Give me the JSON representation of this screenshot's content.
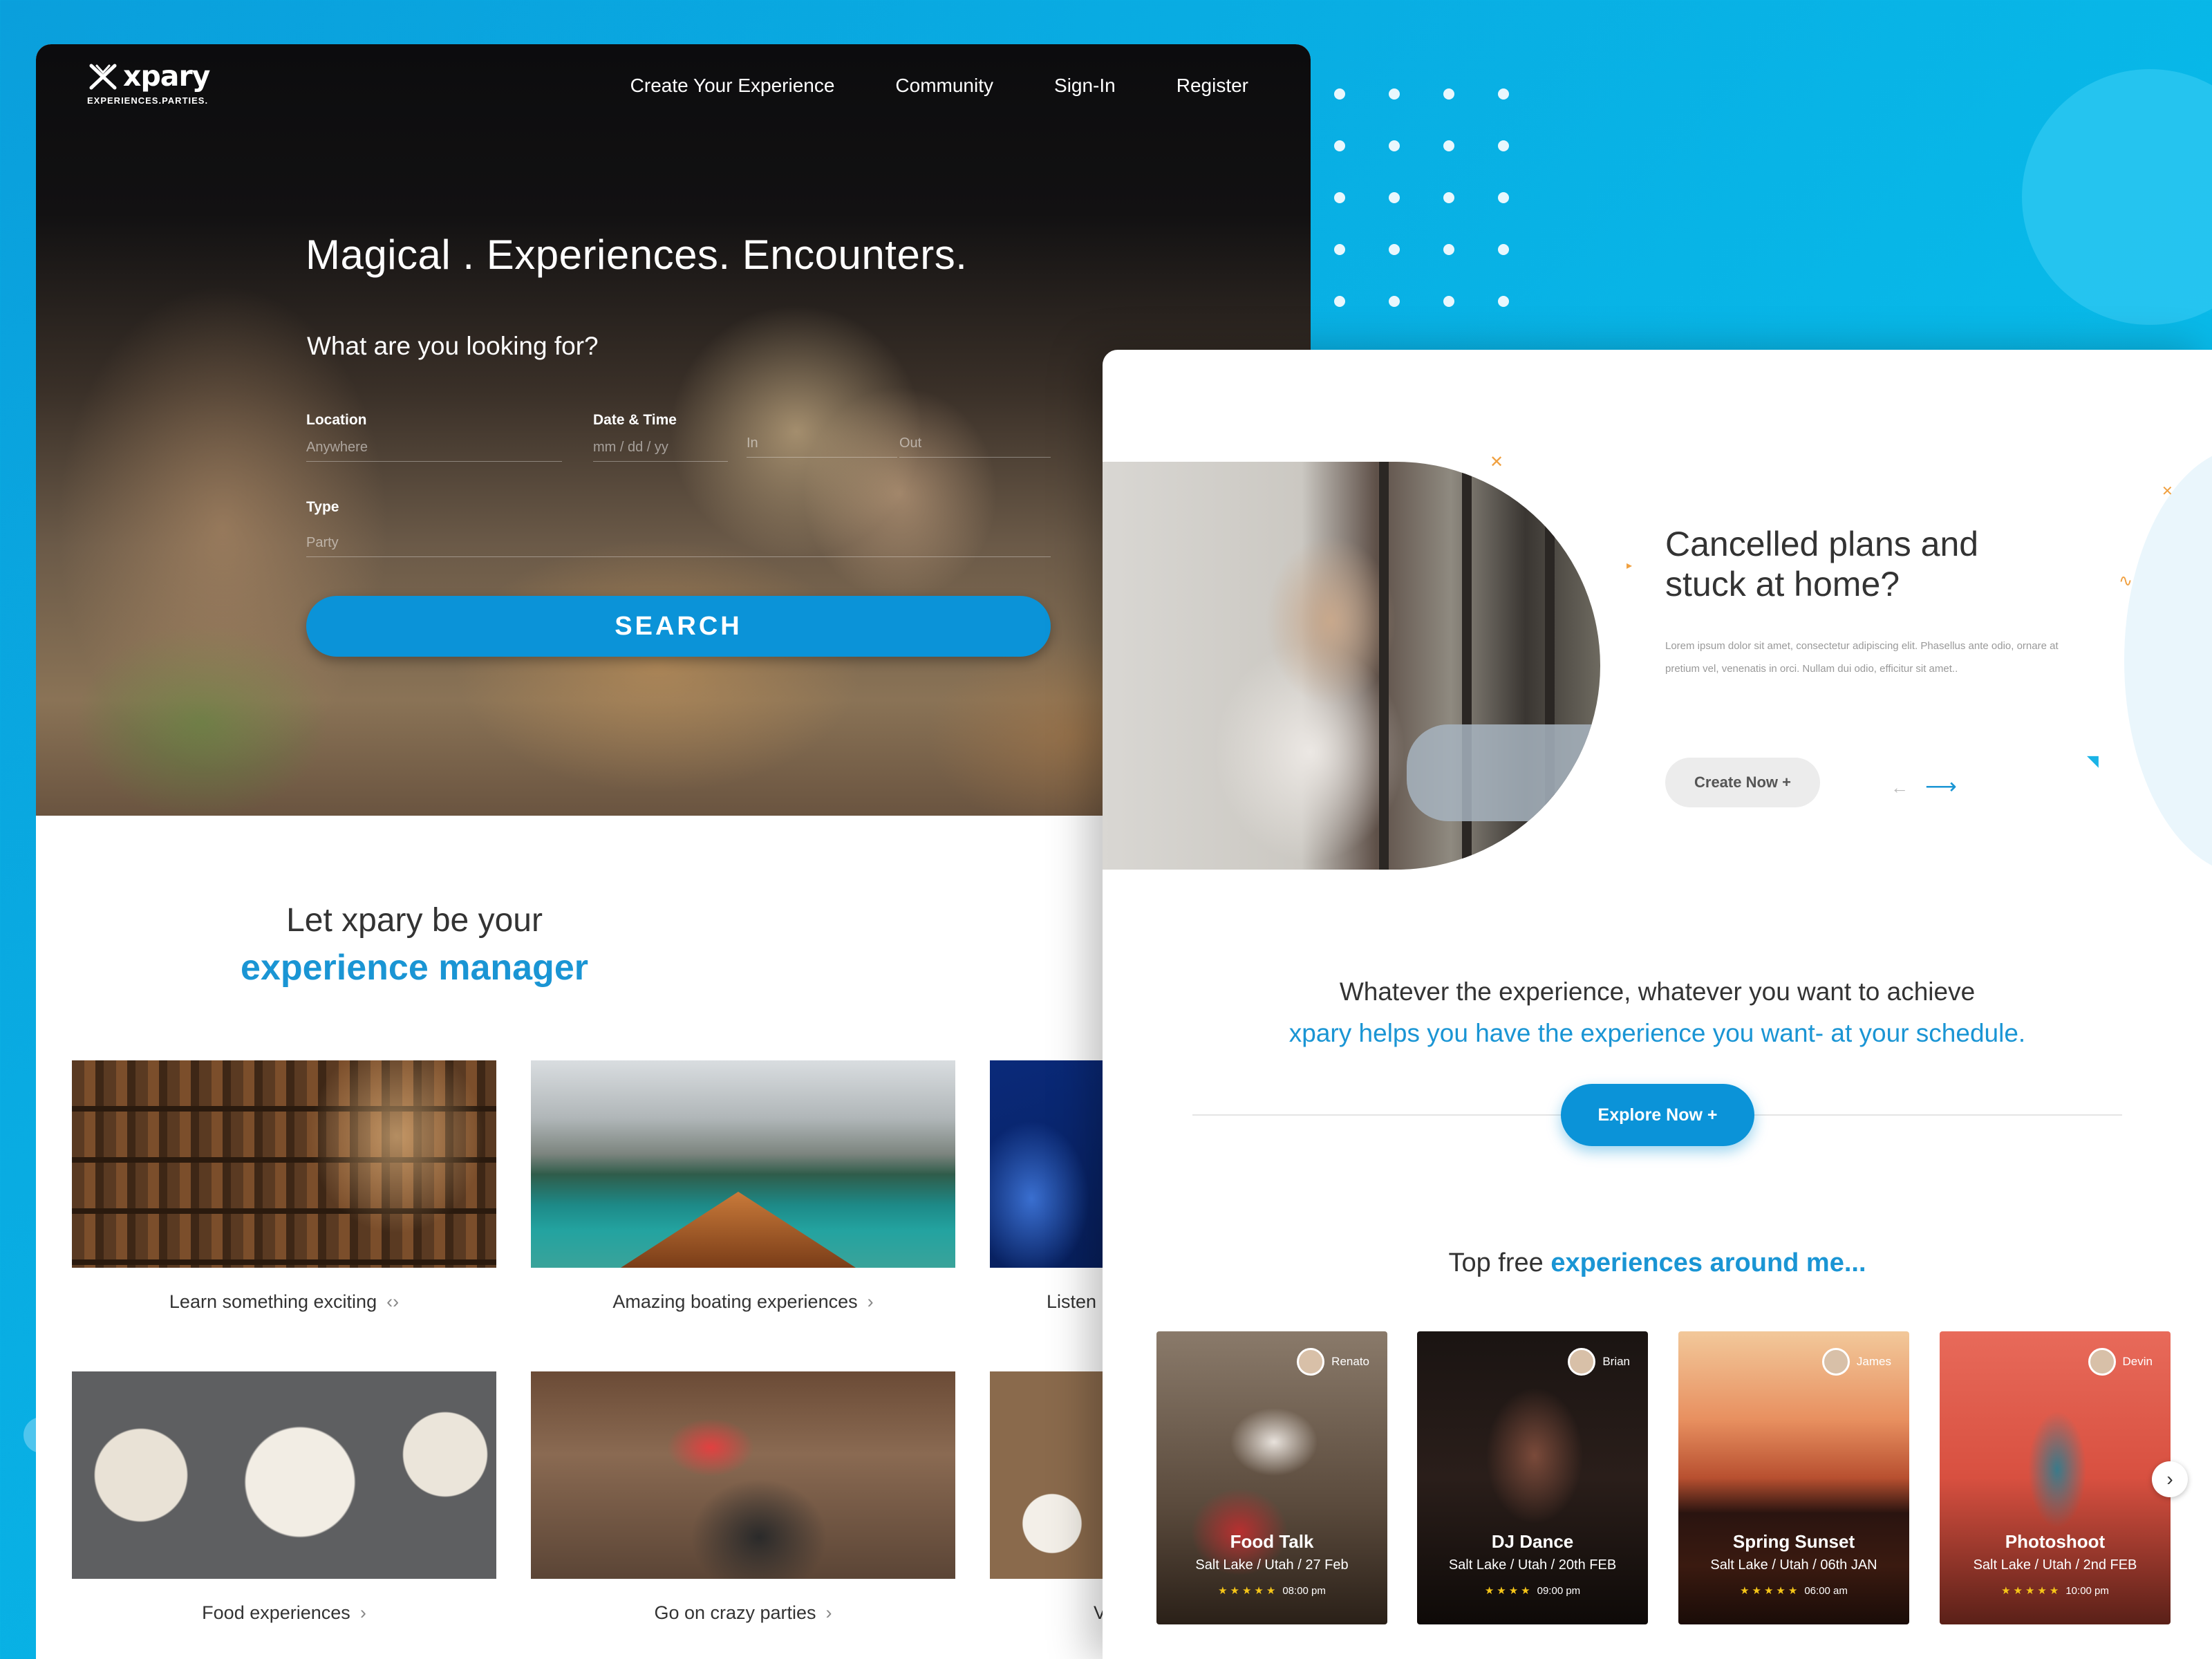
{
  "brand": {
    "name": "xpary",
    "tagline": "EXPERIENCES.PARTIES."
  },
  "nav": [
    "Create Your Experience",
    "Community",
    "Sign-In",
    "Register"
  ],
  "hero": {
    "headline": "Magical . Experiences. Encounters.",
    "question": "What are you looking for?",
    "location": {
      "label": "Location",
      "placeholder": "Anywhere"
    },
    "datetime": {
      "label": "Date & Time",
      "placeholder": "mm / dd / yy",
      "in": "In",
      "out": "Out"
    },
    "type": {
      "label": "Type",
      "placeholder": "Party"
    },
    "search_label": "SEARCH"
  },
  "manager": {
    "line1": "Let xpary be your",
    "line2": "experience manager"
  },
  "categories": [
    {
      "label": "Learn something exciting"
    },
    {
      "label": "Amazing boating experiences"
    },
    {
      "label": "Listen"
    },
    {
      "label": "Food experiences"
    },
    {
      "label": "Go on crazy parties"
    },
    {
      "label": "V"
    }
  ],
  "promo": {
    "title_line1": "Cancelled plans and",
    "title_line2": "stuck at home?",
    "body": "Lorem ipsum dolor sit amet, consectetur adipiscing elit. Phasellus ante odio, ornare at pretium vel, venenatis in orci. Nullam dui odio, efficitur sit amet..",
    "cta": "Create Now +"
  },
  "pitch": {
    "line1": "Whatever the experience, whatever you want to achieve",
    "line2": "xpary helps you have the experience you want- at your schedule.",
    "cta": "Explore Now  +"
  },
  "top": {
    "prefix": "Top free ",
    "highlight": "experiences around me..."
  },
  "experiences": [
    {
      "title": "Food Talk",
      "place": "Salt Lake / Utah / 27 Feb",
      "host": "Renato",
      "time": "08:00 pm",
      "stars": "★★★★★"
    },
    {
      "title": "DJ Dance",
      "place": "Salt Lake / Utah / 20th FEB",
      "host": "Brian",
      "time": "09:00 pm",
      "stars": "★★★★"
    },
    {
      "title": "Spring Sunset",
      "place": "Salt Lake / Utah / 06th JAN",
      "host": "James",
      "time": "06:00 am",
      "stars": "★★★★★"
    },
    {
      "title": "Photoshoot",
      "place": "Salt Lake / Utah / 2nd FEB",
      "host": "Devin",
      "time": "10:00 pm",
      "stars": "★★★★★"
    }
  ],
  "colors": {
    "accent": "#0b93d8",
    "highlight_text": "#1a95d4",
    "background": "#08b8e8"
  }
}
